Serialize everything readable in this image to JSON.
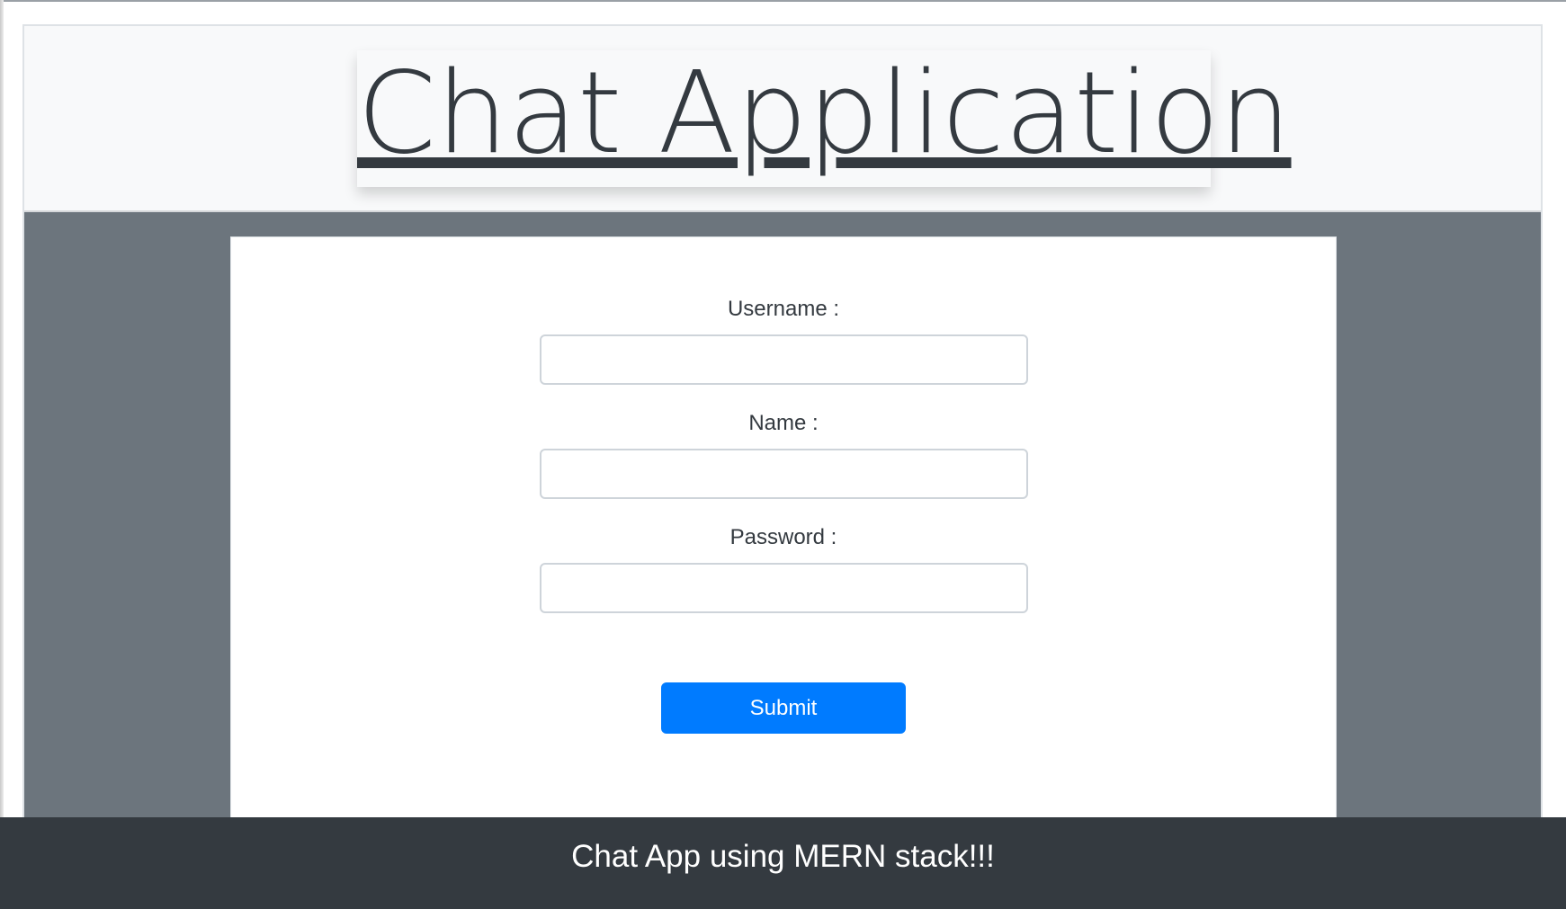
{
  "header": {
    "title": "Chat Application"
  },
  "form": {
    "username_label": "Username :",
    "username_value": "",
    "name_label": "Name :",
    "name_value": "",
    "password_label": "Password :",
    "password_value": "",
    "submit_label": "Submit"
  },
  "footer": {
    "text": "Chat App using MERN stack!!!"
  },
  "colors": {
    "header_bg": "#f8f9fa",
    "page_bg": "#6c757d",
    "card_bg": "#ffffff",
    "primary": "#007bff",
    "footer_bg": "#343a40",
    "text_dark": "#343a40"
  }
}
